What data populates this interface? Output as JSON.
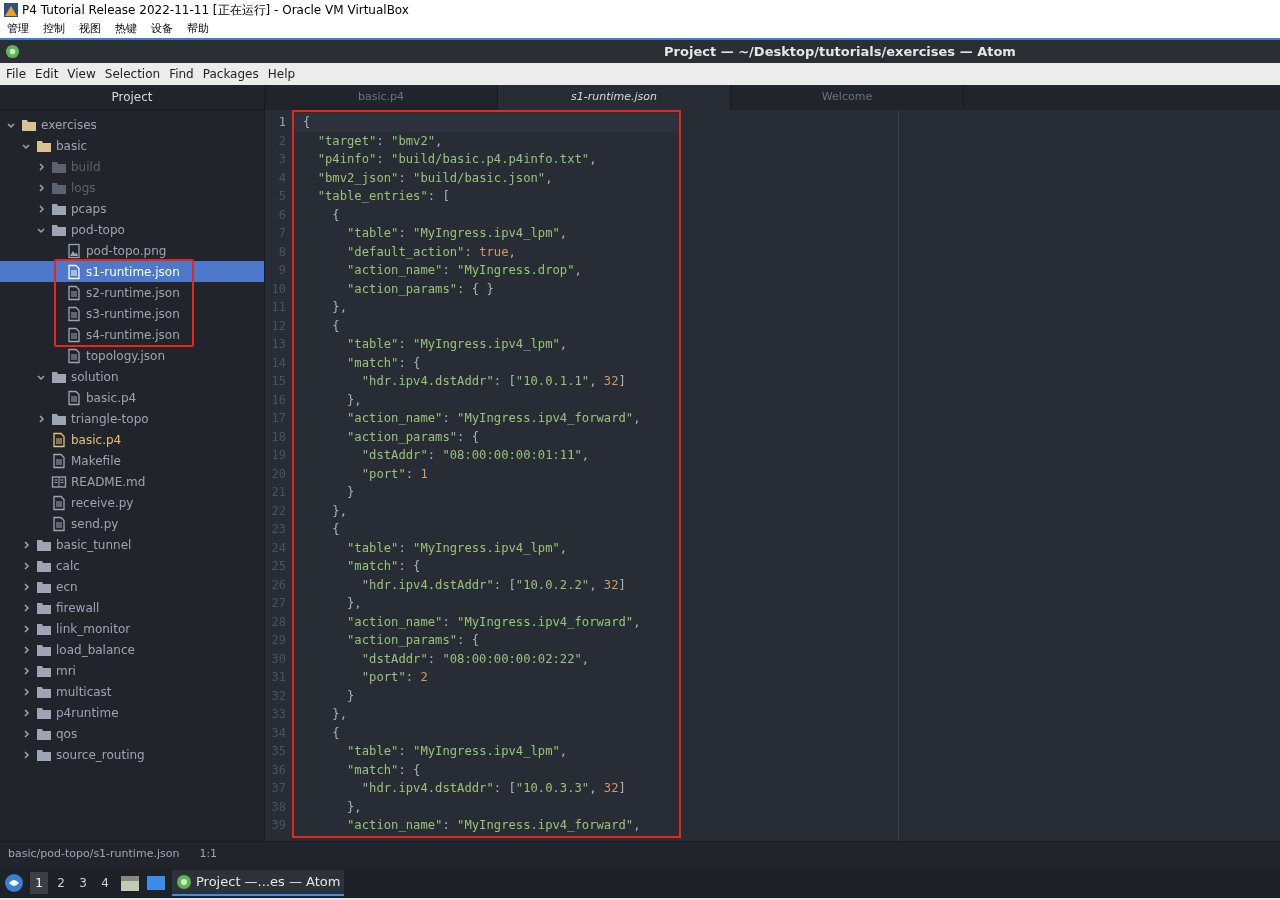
{
  "vm_window": {
    "title": "P4 Tutorial Release 2022-11-11 [正在运行] - Oracle VM VirtualBox",
    "menu": [
      "管理",
      "控制",
      "视图",
      "热键",
      "设备",
      "帮助"
    ]
  },
  "window": {
    "title": "Project — ~/Desktop/tutorials/exercises — Atom"
  },
  "menu": [
    "File",
    "Edit",
    "View",
    "Selection",
    "Find",
    "Packages",
    "Help"
  ],
  "sidebar": {
    "title": "Project",
    "tree": [
      {
        "label": "exercises",
        "kind": "folder",
        "expanded": true,
        "children": [
          {
            "label": "basic",
            "kind": "folder",
            "expanded": true,
            "children": [
              {
                "label": "build",
                "kind": "folder",
                "expanded": false,
                "ignored": true
              },
              {
                "label": "logs",
                "kind": "folder",
                "expanded": false,
                "ignored": true
              },
              {
                "label": "pcaps",
                "kind": "folder",
                "expanded": false
              },
              {
                "label": "pod-topo",
                "kind": "folder",
                "expanded": true,
                "children": [
                  {
                    "label": "pod-topo.png",
                    "kind": "image",
                    "selected": false
                  },
                  {
                    "label": "s1-runtime.json",
                    "kind": "file",
                    "selected": true,
                    "highlighted": true
                  },
                  {
                    "label": "s2-runtime.json",
                    "kind": "file",
                    "selected": false,
                    "highlighted": true
                  },
                  {
                    "label": "s3-runtime.json",
                    "kind": "file",
                    "selected": false,
                    "highlighted": true
                  },
                  {
                    "label": "s4-runtime.json",
                    "kind": "file",
                    "selected": false,
                    "highlighted": true
                  },
                  {
                    "label": "topology.json",
                    "kind": "file",
                    "selected": false
                  }
                ]
              },
              {
                "label": "solution",
                "kind": "folder",
                "expanded": true,
                "children": [
                  {
                    "label": "basic.p4",
                    "kind": "file",
                    "selected": false
                  }
                ]
              },
              {
                "label": "triangle-topo",
                "kind": "folder",
                "expanded": false
              },
              {
                "label": "basic.p4",
                "kind": "file",
                "selected": false,
                "modified": true
              },
              {
                "label": "Makefile",
                "kind": "file",
                "selected": false
              },
              {
                "label": "README.md",
                "kind": "book",
                "selected": false
              },
              {
                "label": "receive.py",
                "kind": "file",
                "selected": false
              },
              {
                "label": "send.py",
                "kind": "file",
                "selected": false
              }
            ]
          },
          {
            "label": "basic_tunnel",
            "kind": "folder",
            "expanded": false
          },
          {
            "label": "calc",
            "kind": "folder",
            "expanded": false
          },
          {
            "label": "ecn",
            "kind": "folder",
            "expanded": false
          },
          {
            "label": "firewall",
            "kind": "folder",
            "expanded": false
          },
          {
            "label": "link_monitor",
            "kind": "folder",
            "expanded": false
          },
          {
            "label": "load_balance",
            "kind": "folder",
            "expanded": false
          },
          {
            "label": "mri",
            "kind": "folder",
            "expanded": false
          },
          {
            "label": "multicast",
            "kind": "folder",
            "expanded": false
          },
          {
            "label": "p4runtime",
            "kind": "folder",
            "expanded": false
          },
          {
            "label": "qos",
            "kind": "folder",
            "expanded": false
          },
          {
            "label": "source_routing",
            "kind": "folder",
            "expanded": false
          }
        ]
      }
    ]
  },
  "tabs": [
    {
      "label": "basic.p4",
      "selected": false
    },
    {
      "label": "s1-runtime.json",
      "selected": true
    },
    {
      "label": "Welcome",
      "selected": false
    }
  ],
  "editor": {
    "highlighted": true,
    "lines": [
      {
        "number": "1",
        "text": "{"
      },
      {
        "number": "2",
        "text": "  \"target\": \"bmv2\","
      },
      {
        "number": "3",
        "text": "  \"p4info\": \"build/basic.p4.p4info.txt\","
      },
      {
        "number": "4",
        "text": "  \"bmv2_json\": \"build/basic.json\","
      },
      {
        "number": "5",
        "text": "  \"table_entries\": ["
      },
      {
        "number": "6",
        "text": "    {"
      },
      {
        "number": "7",
        "text": "      \"table\": \"MyIngress.ipv4_lpm\","
      },
      {
        "number": "8",
        "text": "      \"default_action\": true,"
      },
      {
        "number": "9",
        "text": "      \"action_name\": \"MyIngress.drop\","
      },
      {
        "number": "10",
        "text": "      \"action_params\": { }"
      },
      {
        "number": "11",
        "text": "    },"
      },
      {
        "number": "12",
        "text": "    {"
      },
      {
        "number": "13",
        "text": "      \"table\": \"MyIngress.ipv4_lpm\","
      },
      {
        "number": "14",
        "text": "      \"match\": {"
      },
      {
        "number": "15",
        "text": "        \"hdr.ipv4.dstAddr\": [\"10.0.1.1\", 32]"
      },
      {
        "number": "16",
        "text": "      },"
      },
      {
        "number": "17",
        "text": "      \"action_name\": \"MyIngress.ipv4_forward\","
      },
      {
        "number": "18",
        "text": "      \"action_params\": {"
      },
      {
        "number": "19",
        "text": "        \"dstAddr\": \"08:00:00:00:01:11\","
      },
      {
        "number": "20",
        "text": "        \"port\": 1"
      },
      {
        "number": "21",
        "text": "      }"
      },
      {
        "number": "22",
        "text": "    },"
      },
      {
        "number": "23",
        "text": "    {"
      },
      {
        "number": "24",
        "text": "      \"table\": \"MyIngress.ipv4_lpm\","
      },
      {
        "number": "25",
        "text": "      \"match\": {"
      },
      {
        "number": "26",
        "text": "        \"hdr.ipv4.dstAddr\": [\"10.0.2.2\", 32]"
      },
      {
        "number": "27",
        "text": "      },"
      },
      {
        "number": "28",
        "text": "      \"action_name\": \"MyIngress.ipv4_forward\","
      },
      {
        "number": "29",
        "text": "      \"action_params\": {"
      },
      {
        "number": "30",
        "text": "        \"dstAddr\": \"08:00:00:00:02:22\","
      },
      {
        "number": "31",
        "text": "        \"port\": 2"
      },
      {
        "number": "32",
        "text": "      }"
      },
      {
        "number": "33",
        "text": "    },"
      },
      {
        "number": "34",
        "text": "    {"
      },
      {
        "number": "35",
        "text": "      \"table\": \"MyIngress.ipv4_lpm\","
      },
      {
        "number": "36",
        "text": "      \"match\": {"
      },
      {
        "number": "37",
        "text": "        \"hdr.ipv4.dstAddr\": [\"10.0.3.3\", 32]"
      },
      {
        "number": "38",
        "text": "      },"
      },
      {
        "number": "39",
        "text": "      \"action_name\": \"MyIngress.ipv4_forward\","
      }
    ]
  },
  "status_bar": {
    "path": "basic/pod-topo/s1-runtime.json",
    "cursor": "1:1"
  },
  "taskbar": {
    "workspaces": [
      {
        "label": "1",
        "selected": true
      },
      {
        "label": "2",
        "selected": false
      },
      {
        "label": "3",
        "selected": false
      },
      {
        "label": "4",
        "selected": false
      }
    ],
    "task": "Project —...es — Atom"
  }
}
